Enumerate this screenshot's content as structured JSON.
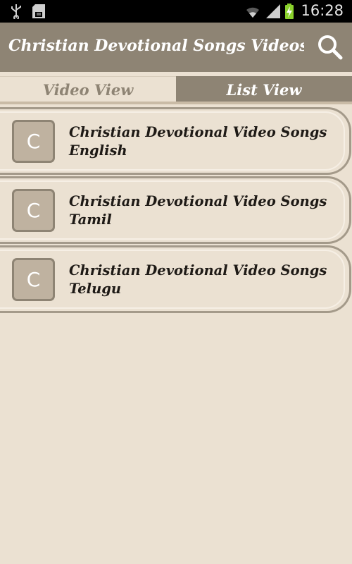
{
  "status_bar": {
    "time": "16:28",
    "icons": [
      "usb-icon",
      "sd-card-icon",
      "wifi-icon",
      "signal-icon",
      "battery-charging-icon"
    ]
  },
  "action_bar": {
    "title": "Christian Devotional Songs Videos...",
    "search_icon": "search-icon"
  },
  "tabs": [
    {
      "label": "Video View",
      "selected": false
    },
    {
      "label": "List View",
      "selected": true
    }
  ],
  "list": {
    "items": [
      {
        "thumb_letter": "C",
        "title": "Christian Devotional Video Songs English"
      },
      {
        "thumb_letter": "C",
        "title": "Christian Devotional Video Songs Tamil"
      },
      {
        "thumb_letter": "C",
        "title": "Christian Devotional Video Songs Telugu"
      }
    ]
  },
  "colors": {
    "background": "#ebe1d2",
    "accent": "#8e8474",
    "border": "#a49a8a",
    "thumb": "#bfb2a0",
    "text_dark": "#1e1a16"
  }
}
